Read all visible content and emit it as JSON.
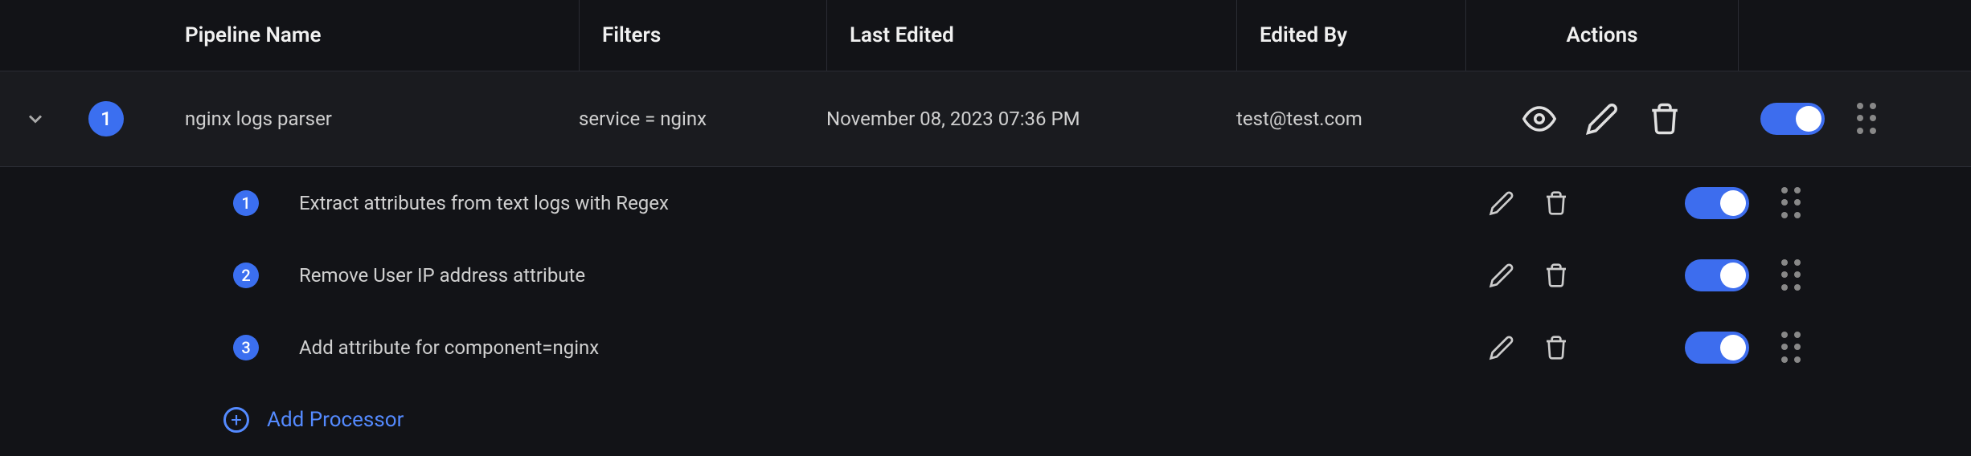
{
  "columns": {
    "name": "Pipeline Name",
    "filters": "Filters",
    "last_edited": "Last Edited",
    "edited_by": "Edited By",
    "actions": "Actions"
  },
  "pipeline": {
    "index": "1",
    "name": "nginx logs parser",
    "filters": "service = nginx",
    "last_edited": "November 08, 2023 07:36 PM",
    "edited_by": "test@test.com",
    "enabled": true
  },
  "processors": [
    {
      "index": "1",
      "name": "Extract attributes from text logs with Regex",
      "enabled": true
    },
    {
      "index": "2",
      "name": "Remove User IP address attribute",
      "enabled": true
    },
    {
      "index": "3",
      "name": "Add attribute for component=nginx",
      "enabled": true
    }
  ],
  "add_processor_label": "Add Processor"
}
